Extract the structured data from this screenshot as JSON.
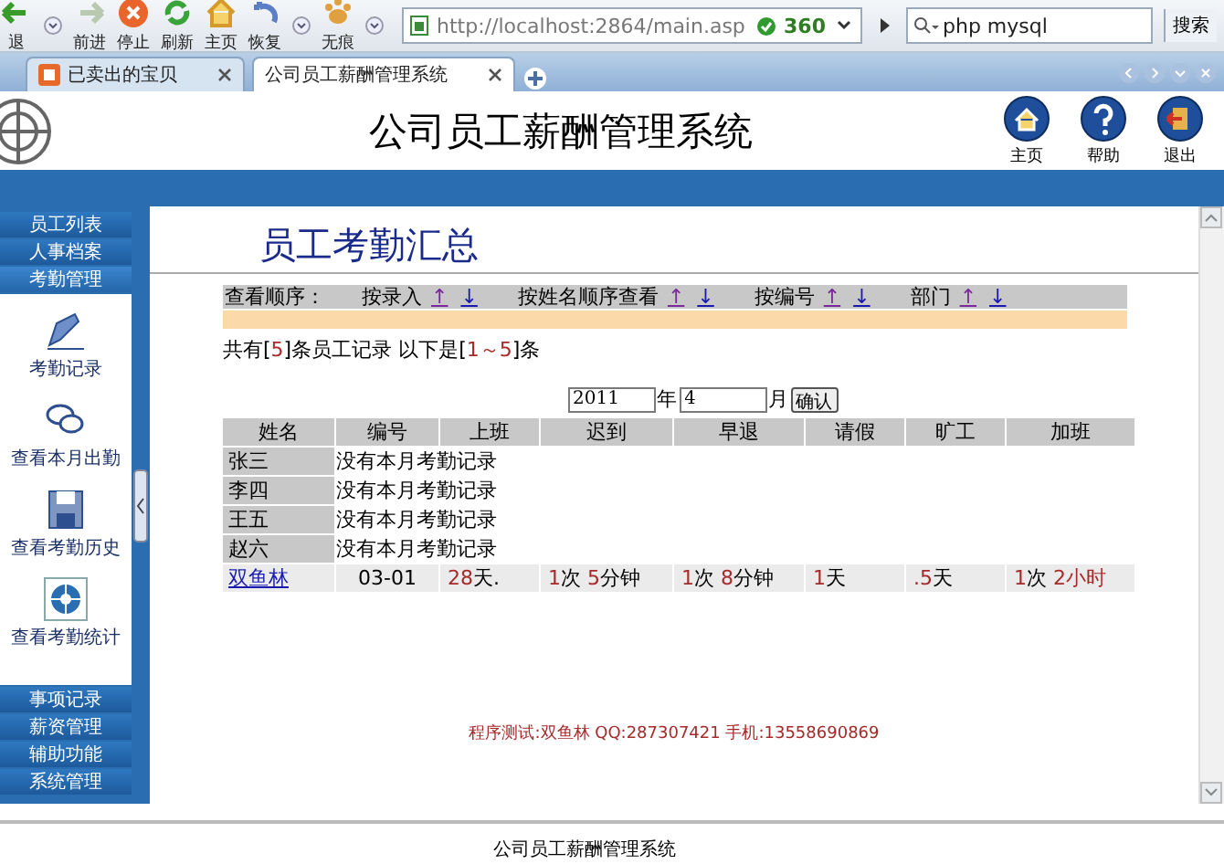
{
  "browser": {
    "nav_buttons": [
      {
        "label": "退"
      },
      {
        "label": "前进"
      },
      {
        "label": "停止"
      },
      {
        "label": "刷新"
      },
      {
        "label": "主页"
      },
      {
        "label": "恢复"
      },
      {
        "label": "无痕"
      }
    ],
    "address": "http://localhost:2864/main.asp",
    "address_badge": "360",
    "search_value": "php mysql",
    "search_button": "搜索"
  },
  "tabs": [
    {
      "label": "已卖出的宝贝",
      "selected": false
    },
    {
      "label": "公司员工薪酬管理系统",
      "selected": true
    }
  ],
  "header": {
    "title": "公司员工薪酬管理系统",
    "actions": [
      {
        "label": "主页",
        "kind": "home"
      },
      {
        "label": "帮助",
        "kind": "help"
      },
      {
        "label": "退出",
        "kind": "exit"
      }
    ]
  },
  "sidebar": {
    "top_items": [
      {
        "label": "员工列表",
        "selected": false
      },
      {
        "label": "人事档案",
        "selected": false
      },
      {
        "label": "考勤管理",
        "selected": true
      }
    ],
    "tools": [
      {
        "label": "考勤记录",
        "kind": "pen"
      },
      {
        "label": "查看本月出勤",
        "kind": "chat"
      },
      {
        "label": "查看考勤历史",
        "kind": "disk"
      },
      {
        "label": "查看考勤统计",
        "kind": "wheel"
      }
    ],
    "bottom_items": [
      {
        "label": "事项记录",
        "selected": false
      },
      {
        "label": "薪资管理",
        "selected": false
      },
      {
        "label": "辅助功能",
        "selected": false
      },
      {
        "label": "系统管理",
        "selected": false
      }
    ]
  },
  "content": {
    "title": "员工考勤汇总",
    "sort": {
      "label": "查看顺序：",
      "options": [
        {
          "label": "按录入",
          "up": "↑",
          "down": "↓"
        },
        {
          "label": "按姓名顺序查看",
          "up": "↑",
          "down": "↓"
        },
        {
          "label": "按编号",
          "up": "↑",
          "down": "↓"
        },
        {
          "label": "部门",
          "up": "↑",
          "down": "↓"
        }
      ]
    },
    "count": [
      {
        "text": "共有[",
        "kind": "plain"
      },
      {
        "text": "5",
        "kind": "num"
      },
      {
        "text": "]条员工记录 以下是[",
        "kind": "plain"
      },
      {
        "text": "1～5",
        "kind": "num"
      },
      {
        "text": "]条",
        "kind": "plain"
      }
    ],
    "date": {
      "year": "2011",
      "year_label": "年",
      "month": "4",
      "month_label": "月",
      "confirm": "确认"
    },
    "columns": [
      "姓名",
      "编号",
      "上班",
      "迟到",
      "早退",
      "请假",
      "旷工",
      "加班"
    ],
    "rows": [
      {
        "kind": "empty",
        "name": "张三",
        "note": "没有本月考勤记录"
      },
      {
        "kind": "empty",
        "name": "李四",
        "note": "没有本月考勤记录"
      },
      {
        "kind": "empty",
        "name": "王五",
        "note": "没有本月考勤记录"
      },
      {
        "kind": "empty",
        "name": "赵六",
        "note": "没有本月考勤记录"
      },
      {
        "kind": "record",
        "name": "双鱼林",
        "cells": [
          [
            {
              "text": "03-01",
              "kind": "plain"
            }
          ],
          [
            {
              "text": "28",
              "kind": "num"
            },
            {
              "text": "天.",
              "kind": "plain"
            }
          ],
          [
            {
              "text": "1",
              "kind": "num"
            },
            {
              "text": "次 ",
              "kind": "plain"
            },
            {
              "text": "5",
              "kind": "num"
            },
            {
              "text": "分钟",
              "kind": "plain"
            }
          ],
          [
            {
              "text": "1",
              "kind": "num"
            },
            {
              "text": "次 ",
              "kind": "plain"
            },
            {
              "text": "8",
              "kind": "num"
            },
            {
              "text": "分钟",
              "kind": "plain"
            }
          ],
          [
            {
              "text": "1",
              "kind": "num"
            },
            {
              "text": "天",
              "kind": "plain"
            }
          ],
          [
            {
              "text": ".5",
              "kind": "num"
            },
            {
              "text": "天",
              "kind": "plain"
            }
          ],
          [
            {
              "text": "1",
              "kind": "num"
            },
            {
              "text": "次 ",
              "kind": "plain"
            },
            {
              "text": "2小时",
              "kind": "num"
            }
          ]
        ]
      }
    ],
    "credits": "程序测试:双鱼林 QQ:287307421 手机:13558690869"
  },
  "footer": "公司员工薪酬管理系统"
}
